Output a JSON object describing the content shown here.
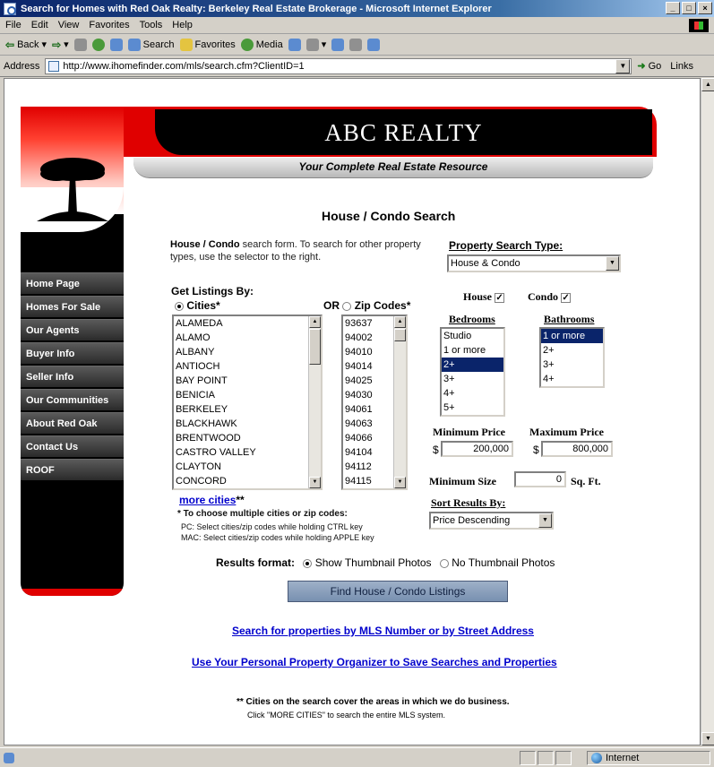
{
  "window": {
    "title": "Search for Homes with Red Oak Realty: Berkeley Real Estate Brokerage - Microsoft Internet Explorer",
    "btn_min": "_",
    "btn_max": "□",
    "btn_close": "×"
  },
  "menu": [
    "File",
    "Edit",
    "View",
    "Favorites",
    "Tools",
    "Help"
  ],
  "toolbar": {
    "back": "Back",
    "search": "Search",
    "favorites": "Favorites",
    "media": "Media"
  },
  "address": {
    "label": "Address",
    "url": "http://www.ihomefinder.com/mls/search.cfm?ClientID=1",
    "go": "Go",
    "links": "Links"
  },
  "status": {
    "zone": "Internet"
  },
  "site": {
    "brand": "ABC REALTY",
    "tagline": "Your Complete Real Estate Resource",
    "nav": [
      "Home Page",
      "Homes For Sale",
      "Our Agents",
      "Buyer Info",
      "Seller Info",
      "Our Communities",
      "About Red Oak",
      "Contact Us",
      "ROOF"
    ]
  },
  "form": {
    "title": "House / Condo Search",
    "intro_bold": "House / Condo",
    "intro_rest": " search form. To search for other property types, use the selector to the right.",
    "property_type_label": "Property Search Type:",
    "property_type_value": "House & Condo",
    "get_listings_label": "Get Listings By:",
    "cities_label": "Cities*",
    "or_label": "OR",
    "zip_label": "Zip Codes*",
    "cities": [
      "ALAMEDA",
      "ALAMO",
      "ALBANY",
      "ANTIOCH",
      "BAY POINT",
      "BENICIA",
      "BERKELEY",
      "BLACKHAWK",
      "BRENTWOOD",
      "CASTRO VALLEY",
      "CLAYTON",
      "CONCORD"
    ],
    "zips": [
      "93637",
      "94002",
      "94010",
      "94014",
      "94025",
      "94030",
      "94061",
      "94063",
      "94066",
      "94104",
      "94112",
      "94115"
    ],
    "house_label": "House",
    "condo_label": "Condo",
    "bedrooms_label": "Bedrooms",
    "bathrooms_label": "Bathrooms",
    "bedrooms": [
      "Studio",
      "1 or more",
      "2+",
      "3+",
      "4+",
      "5+"
    ],
    "bedrooms_selected": 2,
    "bathrooms": [
      "1 or more",
      "2+",
      "3+",
      "4+"
    ],
    "bathrooms_selected": 0,
    "min_price_label": "Minimum Price",
    "max_price_label": "Maximum Price",
    "currency": "$",
    "min_price": "200,000",
    "max_price": "800,000",
    "min_size_label": "Minimum Size",
    "min_size_value": "0",
    "sqft_label": "Sq. Ft.",
    "sort_label": "Sort Results By:",
    "sort_value": "Price Descending",
    "more_cities": "more cities",
    "more_cities_suffix": "**",
    "choose_note": "* To choose multiple cities or zip codes:",
    "pc_note": "PC: Select cities/zip codes while holding CTRL key",
    "mac_note": "MAC: Select cities/zip codes while holding APPLE key",
    "results_format_label": "Results format:",
    "show_thumbs": "Show Thumbnail Photos",
    "no_thumbs": "No Thumbnail Photos",
    "find_button": "Find House / Condo Listings",
    "mls_link": "Search for properties by MLS Number or by Street Address",
    "organizer_link": "Use Your Personal Property Organizer to Save Searches and Properties",
    "footnote_bold": "** Cities on the search cover the areas in which we do business.",
    "footnote_sub": "Click \"MORE CITIES\" to search the entire MLS system."
  },
  "colors": {
    "brand_red": "#e00000",
    "link_blue": "#0000cc",
    "select_blue": "#0a246a"
  }
}
